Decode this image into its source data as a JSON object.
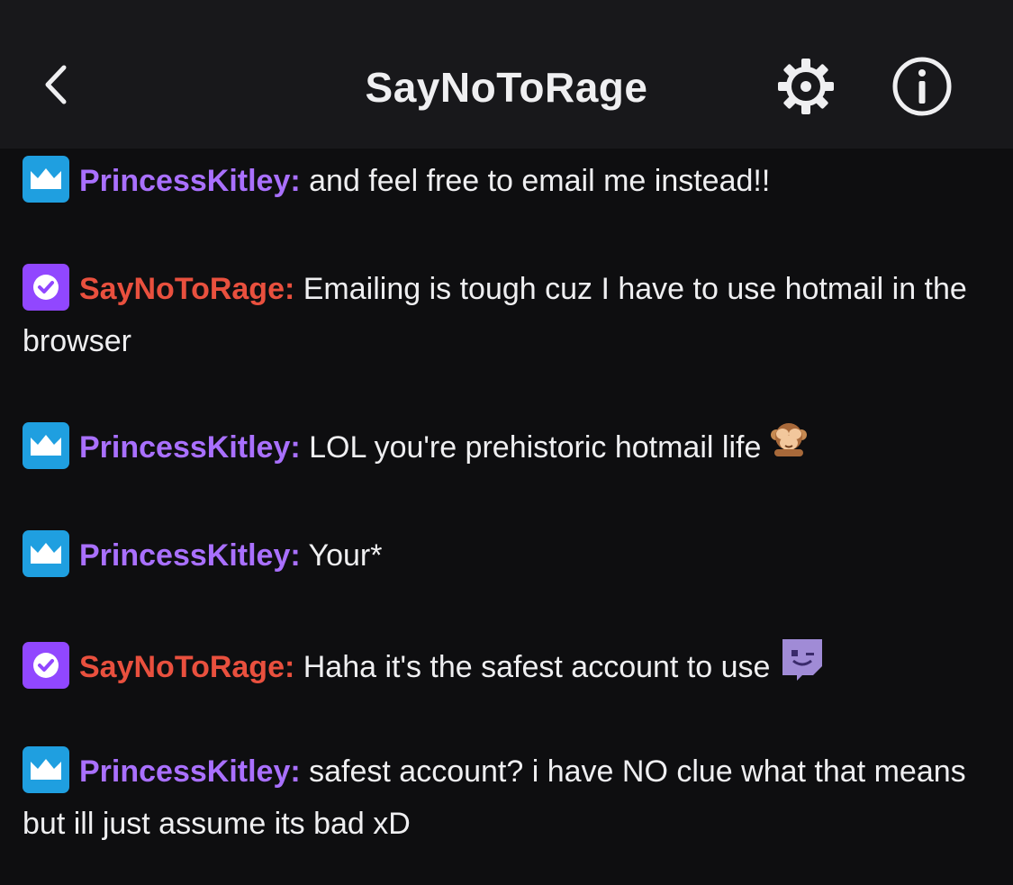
{
  "header": {
    "title": "SayNoToRage",
    "back_icon": "chevron-left-icon",
    "settings_icon": "gear-icon",
    "info_icon": "info-circle-icon"
  },
  "colors": {
    "background": "#0e0e10",
    "header_background": "#18181b",
    "subscriber_badge": "#1f9fe0",
    "broadcaster_badge": "#9147ff",
    "princesskitley_name": "#a970ff",
    "saynotorage_name": "#e9503e",
    "text": "#efeff1"
  },
  "messages": [
    {
      "badge": "subscriber-crown-icon",
      "username": "PrincessKitley:",
      "text": "and feel free to email me instead!!"
    },
    {
      "badge": "verified-check-icon",
      "username": "SayNoToRage:",
      "text": "Emailing is tough cuz I have to use hotmail in the browser"
    },
    {
      "badge": "subscriber-crown-icon",
      "username": "PrincessKitley:",
      "text": "LOL you're prehistoric hotmail life",
      "emoji": "see-no-evil-monkey-emoji"
    },
    {
      "badge": "subscriber-crown-icon",
      "username": "PrincessKitley:",
      "text": "Your*"
    },
    {
      "badge": "verified-check-icon",
      "username": "SayNoToRage:",
      "text": "Haha it's the safest account to use",
      "emoji": "glitch-wink-emote"
    },
    {
      "badge": "subscriber-crown-icon",
      "username": "PrincessKitley:",
      "text": "safest account? i have NO clue what that means but ill just assume its bad xD"
    }
  ]
}
